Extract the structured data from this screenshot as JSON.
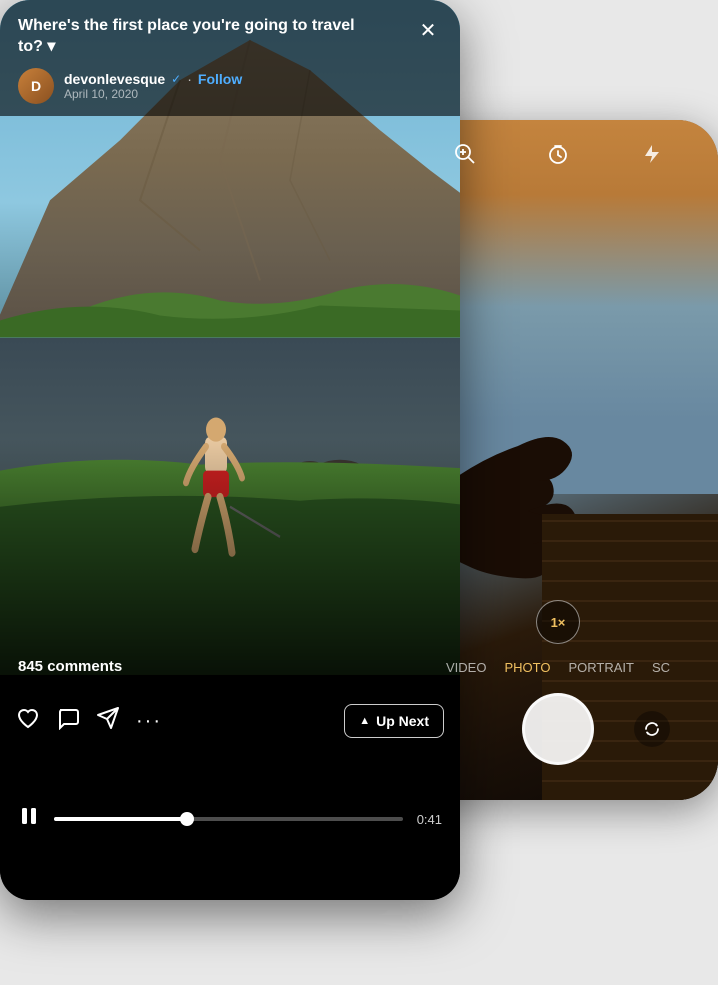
{
  "camera": {
    "modes": [
      "VIDEO",
      "PHOTO",
      "PORTRAIT",
      "SC"
    ],
    "active_mode": "PHOTO",
    "zoom": "1×",
    "top_icons": [
      "magnify-icon",
      "timer-icon",
      "flash-icon"
    ]
  },
  "post": {
    "title": "Where's the first place you're going to travel to? ▾",
    "author": {
      "name": "devonlevesque",
      "verified": true,
      "date": "April 10, 2020"
    },
    "follow_label": "Follow",
    "comments_count": "845 comments",
    "up_next_label": "Up Next",
    "time_current": "0:41",
    "actions": {
      "like_icon": "♡",
      "comment_icon": "○",
      "share_icon": "▷",
      "more_icon": "···"
    }
  }
}
